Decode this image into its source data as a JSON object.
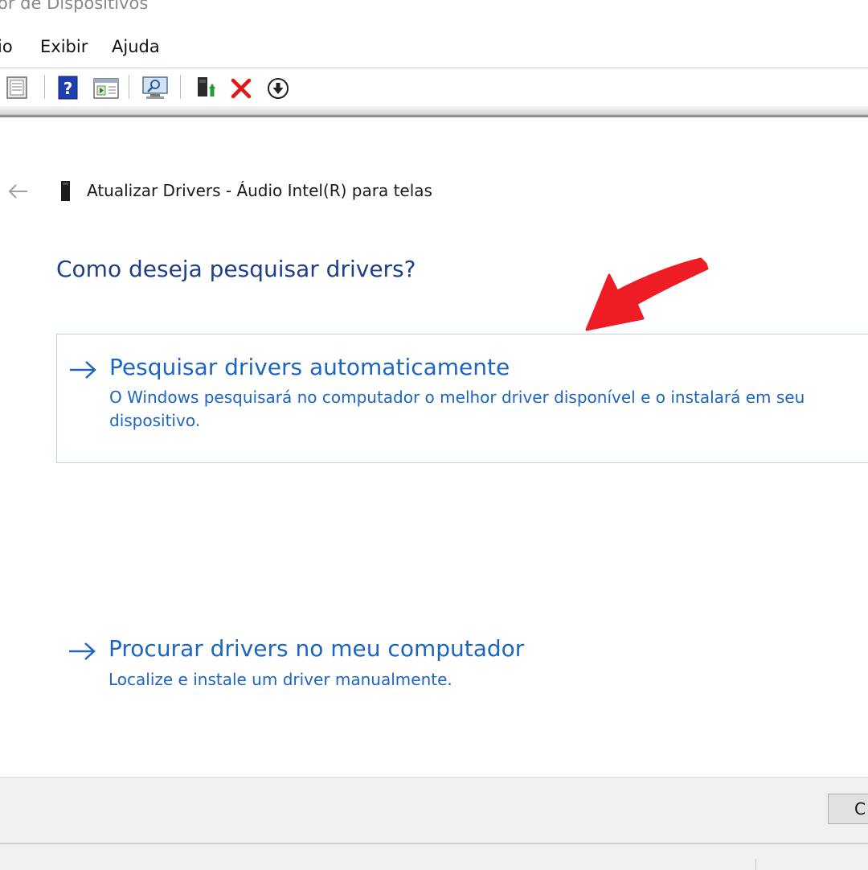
{
  "window": {
    "title_fragment": "or de Dispositivos"
  },
  "menu": {
    "items": [
      "io",
      "Exibir",
      "Ajuda"
    ]
  },
  "toolbar": {
    "icons": [
      "properties-icon",
      "help-icon",
      "view-icon",
      "scan-hardware-icon",
      "update-driver-icon",
      "uninstall-icon",
      "disable-device-icon"
    ]
  },
  "dialog": {
    "title": "Atualizar Drivers - Áudio Intel(R) para telas",
    "question": "Como deseja pesquisar drivers?",
    "options": [
      {
        "title": "Pesquisar drivers automaticamente",
        "description": "O Windows pesquisará no computador o melhor driver disponível e o instalará em seu dispositivo."
      },
      {
        "title": "Procurar drivers no meu computador",
        "description": "Localize e instale um driver manualmente."
      }
    ],
    "footer_button": "C"
  },
  "colors": {
    "link": "#1c65c2",
    "heading": "#1e3f8a",
    "annotation": "#ee1c24"
  }
}
